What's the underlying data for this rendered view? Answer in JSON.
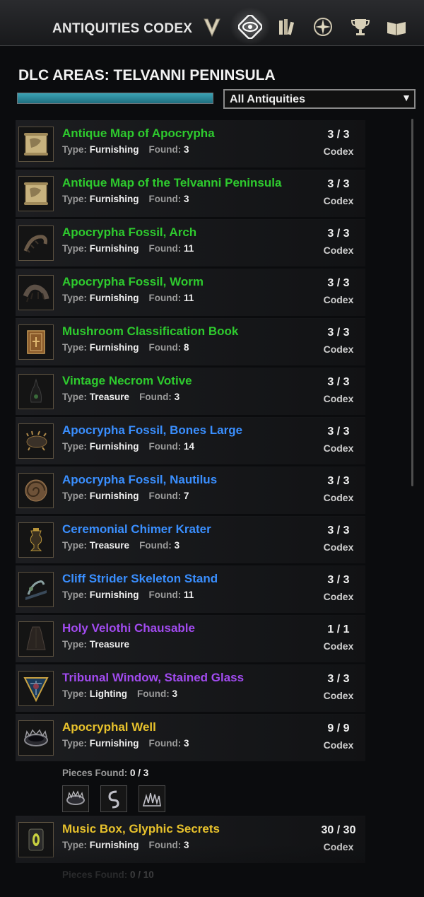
{
  "header": {
    "title": "ANTIQUITIES CODEX",
    "tabs": [
      {
        "icon": "destruction-v-icon"
      },
      {
        "icon": "antiquities-eye-icon",
        "active": true
      },
      {
        "icon": "books-icon"
      },
      {
        "icon": "star-compass-icon"
      },
      {
        "icon": "trophy-icon"
      },
      {
        "icon": "open-book-icon"
      }
    ]
  },
  "sub": {
    "title": "DLC AREAS: TELVANNI PENINSULA",
    "progress": 1.0,
    "filter_value": "All Antiquities",
    "filter_arrow": "▼"
  },
  "labels": {
    "type": "Type:",
    "found": "Found:",
    "codex": "Codex",
    "pieces_found": "Pieces Found:"
  },
  "colors": {
    "green": "#2ecb2e",
    "blue": "#3a8fff",
    "purple": "#a24bf0",
    "gold": "#e8c22c",
    "accent_progress": "#3aa2b4"
  },
  "items": [
    {
      "name": "Antique Map of Apocrypha",
      "type": "Furnishing",
      "found": "3",
      "count": "3 / 3",
      "quality": "green",
      "icon": "map-scroll-icon"
    },
    {
      "name": "Antique Map of the Telvanni Peninsula",
      "type": "Furnishing",
      "found": "3",
      "count": "3 / 3",
      "quality": "green",
      "icon": "map-scroll-icon"
    },
    {
      "name": "Apocrypha Fossil, Arch",
      "type": "Furnishing",
      "found": "11",
      "count": "3 / 3",
      "quality": "green",
      "icon": "fossil-arch-icon"
    },
    {
      "name": "Apocrypha Fossil, Worm",
      "type": "Furnishing",
      "found": "11",
      "count": "3 / 3",
      "quality": "green",
      "icon": "fossil-worm-icon"
    },
    {
      "name": "Mushroom Classification Book",
      "type": "Furnishing",
      "found": "8",
      "count": "3 / 3",
      "quality": "green",
      "icon": "book-icon"
    },
    {
      "name": "Vintage Necrom Votive",
      "type": "Treasure",
      "found": "3",
      "count": "3 / 3",
      "quality": "green",
      "icon": "votive-icon"
    },
    {
      "name": "Apocrypha Fossil, Bones Large",
      "type": "Furnishing",
      "found": "14",
      "count": "3 / 3",
      "quality": "blue",
      "icon": "fossil-bones-icon"
    },
    {
      "name": "Apocrypha Fossil, Nautilus",
      "type": "Furnishing",
      "found": "7",
      "count": "3 / 3",
      "quality": "blue",
      "icon": "nautilus-icon"
    },
    {
      "name": "Ceremonial Chimer Krater",
      "type": "Treasure",
      "found": "3",
      "count": "3 / 3",
      "quality": "blue",
      "icon": "krater-icon"
    },
    {
      "name": "Cliff Strider Skeleton Stand",
      "type": "Furnishing",
      "found": "11",
      "count": "3 / 3",
      "quality": "blue",
      "icon": "skeleton-stand-icon"
    },
    {
      "name": "Holy Velothi Chausable",
      "type": "Treasure",
      "found": "",
      "count": "1 / 1",
      "quality": "purple",
      "icon": "robe-icon"
    },
    {
      "name": "Tribunal Window, Stained Glass",
      "type": "Lighting",
      "found": "3",
      "count": "3 / 3",
      "quality": "purple",
      "icon": "stained-glass-icon"
    },
    {
      "name": "Apocryphal Well",
      "type": "Furnishing",
      "found": "3",
      "count": "9 / 9",
      "quality": "gold",
      "icon": "well-icon",
      "pieces_found": "0 / 3",
      "pieces": [
        "well-ring-piece-icon",
        "serpent-piece-icon",
        "spikes-piece-icon"
      ]
    },
    {
      "name": "Music Box, Glyphic Secrets",
      "type": "Furnishing",
      "found": "3",
      "count": "30 / 30",
      "quality": "gold",
      "icon": "music-box-icon",
      "pieces_found": "0 / 10"
    }
  ]
}
